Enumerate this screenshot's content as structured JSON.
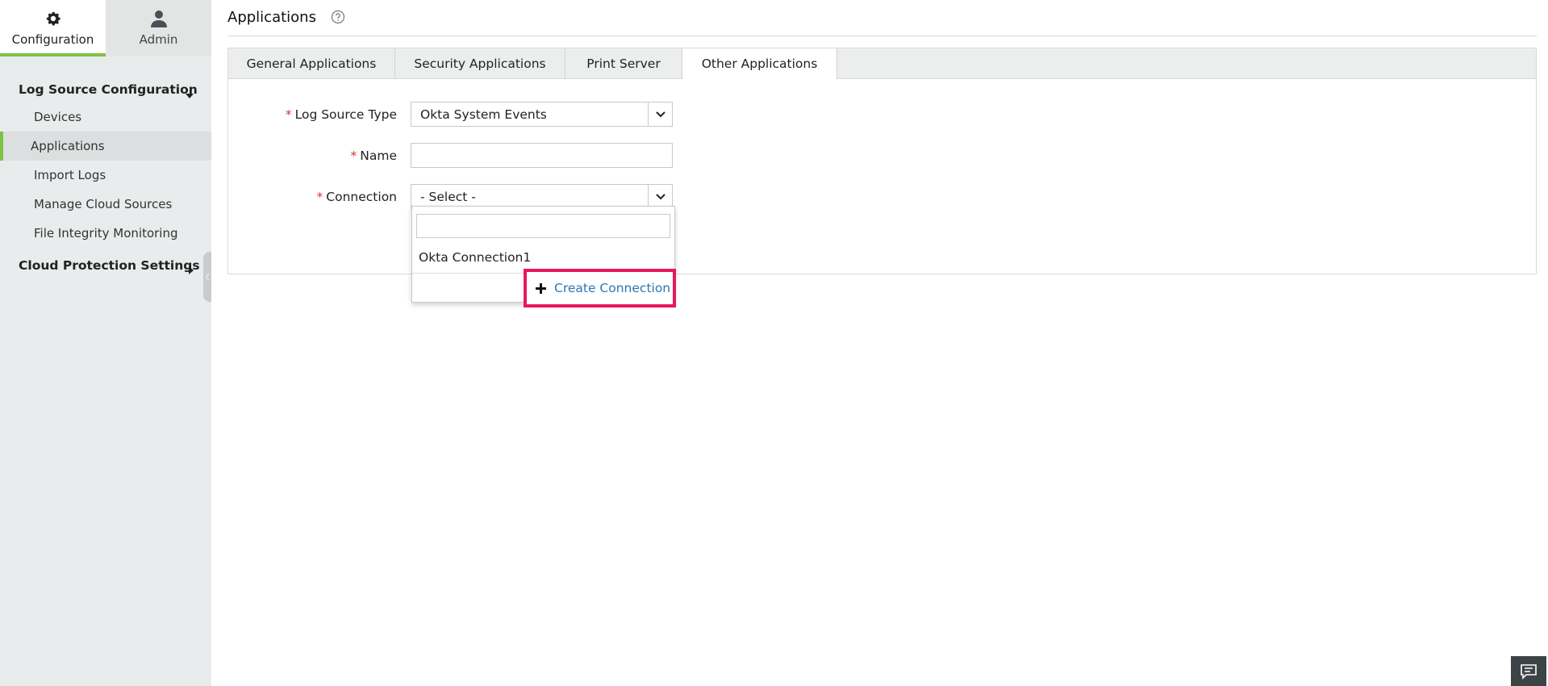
{
  "top_tabs": {
    "configuration": "Configuration",
    "admin": "Admin"
  },
  "sidebar": {
    "section1": "Log Source Configuration",
    "items": [
      {
        "label": "Devices"
      },
      {
        "label": "Applications"
      },
      {
        "label": "Import Logs"
      },
      {
        "label": "Manage Cloud Sources"
      },
      {
        "label": "File Integrity Monitoring"
      }
    ],
    "section2": "Cloud Protection Settings"
  },
  "header": {
    "title": "Applications"
  },
  "tabs": [
    {
      "label": "General Applications"
    },
    {
      "label": "Security Applications"
    },
    {
      "label": "Print Server"
    },
    {
      "label": "Other Applications"
    }
  ],
  "form": {
    "required_mark": "*",
    "log_source_type_label": "Log Source Type",
    "log_source_type_value": "Okta System Events",
    "name_label": "Name",
    "name_value": "",
    "connection_label": "Connection",
    "connection_value": "- Select -"
  },
  "dropdown": {
    "search_value": "",
    "options": [
      {
        "label": "Okta Connection1"
      }
    ],
    "create_label": "Create Connection"
  },
  "colors": {
    "accent_green": "#7ec242",
    "highlight_pink": "#e8175d",
    "link_blue": "#2a78b6",
    "required_red": "#dd3333"
  }
}
